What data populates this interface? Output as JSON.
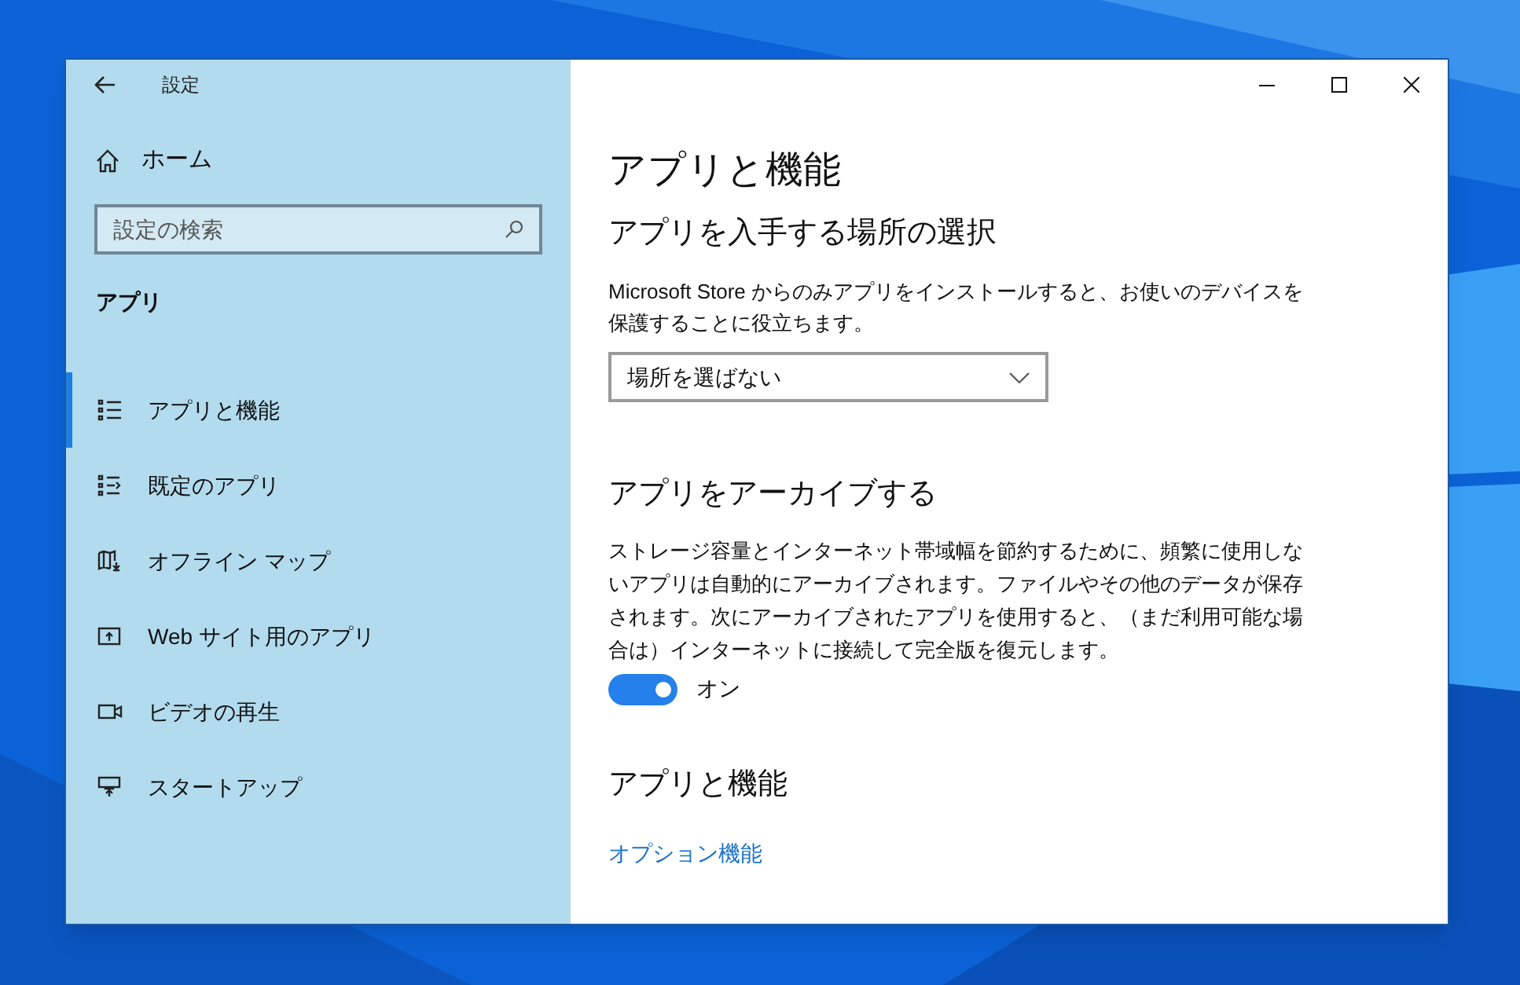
{
  "window": {
    "title": "設定"
  },
  "sidebar": {
    "home": "ホーム",
    "search": {
      "placeholder": "設定の検索"
    },
    "section": "アプリ",
    "items": [
      {
        "label": "アプリと機能",
        "selected": true
      },
      {
        "label": "既定のアプリ",
        "selected": false
      },
      {
        "label": "オフライン マップ",
        "selected": false
      },
      {
        "label": "Web サイト用のアプリ",
        "selected": false
      },
      {
        "label": "ビデオの再生",
        "selected": false
      },
      {
        "label": "スタートアップ",
        "selected": false
      }
    ]
  },
  "content": {
    "title": "アプリと機能",
    "install_source": {
      "heading": "アプリを入手する場所の選択",
      "description": "Microsoft Store からのみアプリをインストールすると、お使いのデバイスを保護することに役立ちます。",
      "dropdown": {
        "value": "場所を選ばない"
      }
    },
    "archive": {
      "heading": "アプリをアーカイブする",
      "description": "ストレージ容量とインターネット帯域幅を節約するために、頻繁に使用しないアプリは自動的にアーカイブされます。ファイルやその他のデータが保存されます。次にアーカイブされたアプリを使用すると、（まだ利用可能な場合は）インターネットに接続して完全版を復元します。",
      "toggle": {
        "on": true,
        "label": "オン"
      }
    },
    "features": {
      "heading": "アプリと機能",
      "link": "オプション機能"
    }
  }
}
